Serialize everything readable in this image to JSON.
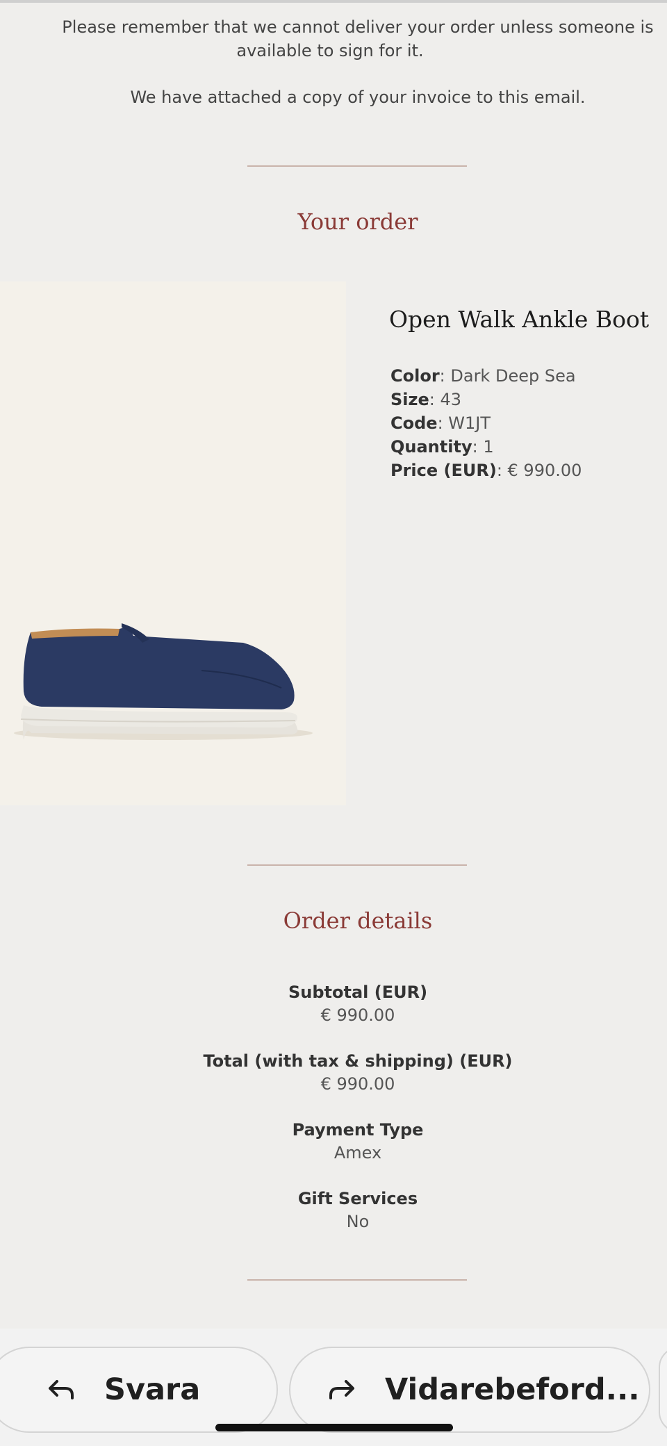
{
  "email": {
    "intro_line1": "Please remember that we cannot deliver your order unless someone is",
    "intro_line2": "available to sign for it.",
    "attachment_note": "We have attached a copy of your invoice to this email.",
    "your_order_title": "Your order",
    "product": {
      "name": "Open Walk Ankle Boot",
      "attributes": [
        {
          "label": "Color",
          "value": "Dark Deep Sea"
        },
        {
          "label": "Size",
          "value": "43"
        },
        {
          "label": "Code",
          "value": "W1JT"
        },
        {
          "label": "Quantity",
          "value": "1"
        },
        {
          "label": "Price (EUR)",
          "value": "€ 990.00"
        }
      ],
      "shoe_color": "#2b3a63"
    },
    "order_details_title": "Order details",
    "details": [
      {
        "label": "Subtotal (EUR)",
        "value": "€ 990.00"
      },
      {
        "label": "Total (with tax & shipping) (EUR)",
        "value": "€ 990.00"
      },
      {
        "label": "Payment Type",
        "value": "Amex"
      },
      {
        "label": "Gift Services",
        "value": "No"
      }
    ]
  },
  "actions": {
    "reply_label": "Svara",
    "forward_label": "Vidarebeford...",
    "reply_icon": "reply-arrow-icon",
    "forward_icon": "forward-arrow-icon"
  },
  "colors": {
    "accent": "#8a3a36",
    "divider": "#c9b3ab",
    "background": "#efeeec"
  }
}
